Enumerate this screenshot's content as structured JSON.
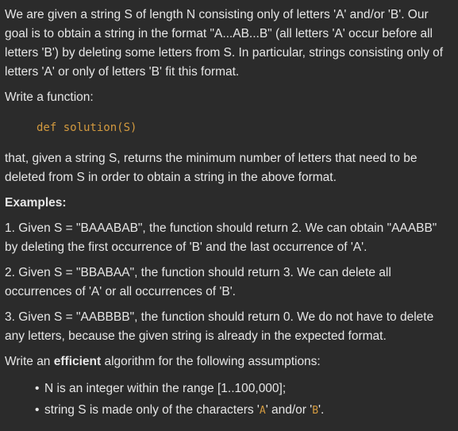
{
  "intro": "We are given a string S of length N consisting only of letters 'A' and/or 'B'. Our goal is to obtain a string in the format \"A...AB...B\" (all letters 'A' occur before all letters 'B') by deleting some letters from S. In particular, strings consisting only of letters 'A' or only of letters 'B' fit this format.",
  "write_function": "Write a function:",
  "code_signature": "def solution(S)",
  "description": "that, given a string S, returns the minimum number of letters that need to be deleted from S in order to obtain a string in the above format.",
  "examples_heading": "Examples:",
  "examples": [
    "1. Given S = \"BAAABAB\", the function should return 2. We can obtain \"AAABB\" by deleting the first occurrence of 'B' and the last occurrence of 'A'.",
    "2. Given S = \"BBABAA\", the function should return 3. We can delete all occurrences of 'A' or all occurrences of 'B'.",
    "3. Given S = \"AABBBB\", the function should return 0. We do not have to delete any letters, because the given string is already in the expected format."
  ],
  "efficient": {
    "before": "Write an ",
    "bold": "efficient",
    "after": " algorithm for the following assumptions:"
  },
  "bullet_symbol": "•",
  "assumption_1": "N is an integer within the range [1..100,000];",
  "assumption_2": {
    "text_1": "string S is made only of the characters '",
    "code_1": "A",
    "text_2": "' and/or '",
    "code_2": "B",
    "text_3": "'."
  }
}
